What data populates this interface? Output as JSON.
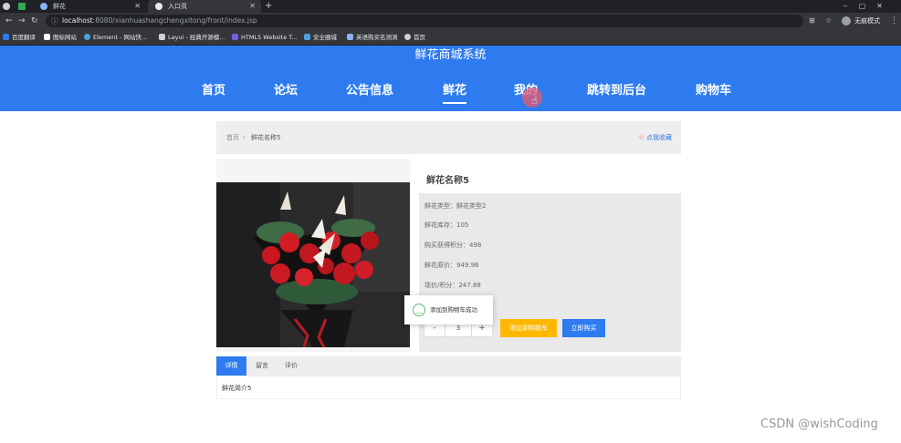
{
  "browser": {
    "tabs": [
      {
        "label": "",
        "icon": "app-icon"
      },
      {
        "label": "",
        "icon": "grid-icon"
      },
      {
        "label": "鲜花"
      },
      {
        "label": "入口页"
      }
    ],
    "new_tab": "+",
    "url_host": "localhost",
    "url_path": ":8080/xianhuashangchengxitong/front/index.jsp",
    "incognito_label": "无痕模式",
    "bookmarks": [
      {
        "label": "百度翻译",
        "color": "#2e7bef"
      },
      {
        "label": "图标网站",
        "color": "#ffffff"
      },
      {
        "label": "Element - 网站快...",
        "color": "#4aa3df"
      },
      {
        "label": "Layui - 经典开源模...",
        "color": "#cfd1d4"
      },
      {
        "label": "HTML5 Website T...",
        "color": "#7b5ce6"
      },
      {
        "label": "安全圈城",
        "color": "#4aa3df"
      },
      {
        "label": "英语购买名测测",
        "color": "#8ab4f8"
      },
      {
        "label": "首页",
        "color": "#cfd1d4"
      }
    ]
  },
  "site": {
    "title": "鲜花商城系统",
    "nav": [
      "首页",
      "论坛",
      "公告信息",
      "鲜花",
      "我的",
      "跳转到后台",
      "购物车"
    ],
    "active_nav": "鲜花",
    "brand_color": "#2e7bef"
  },
  "breadcrumb": {
    "home": "首页",
    "separator": "›",
    "current": "鲜花名称5",
    "collect": "点我收藏"
  },
  "product": {
    "name": "鲜花名称5",
    "rows": [
      "鲜花类型：鲜花类型2",
      "鲜花库存：105",
      "购买获得积分：498",
      "鲜花原价：949.96",
      "现价/积分：247.88"
    ],
    "quantity": "3",
    "minus": "-",
    "plus": "+",
    "add_to_cart": "添加到购物车",
    "buy_now": "立即购买"
  },
  "toast": {
    "message": "添加到购物车成功",
    "icon": "smile-icon"
  },
  "detail_tabs": {
    "tabs": [
      "详情",
      "留言",
      "评价"
    ],
    "active": "详情",
    "content": "鲜花简介5"
  },
  "watermark": "CSDN @wishCoding"
}
